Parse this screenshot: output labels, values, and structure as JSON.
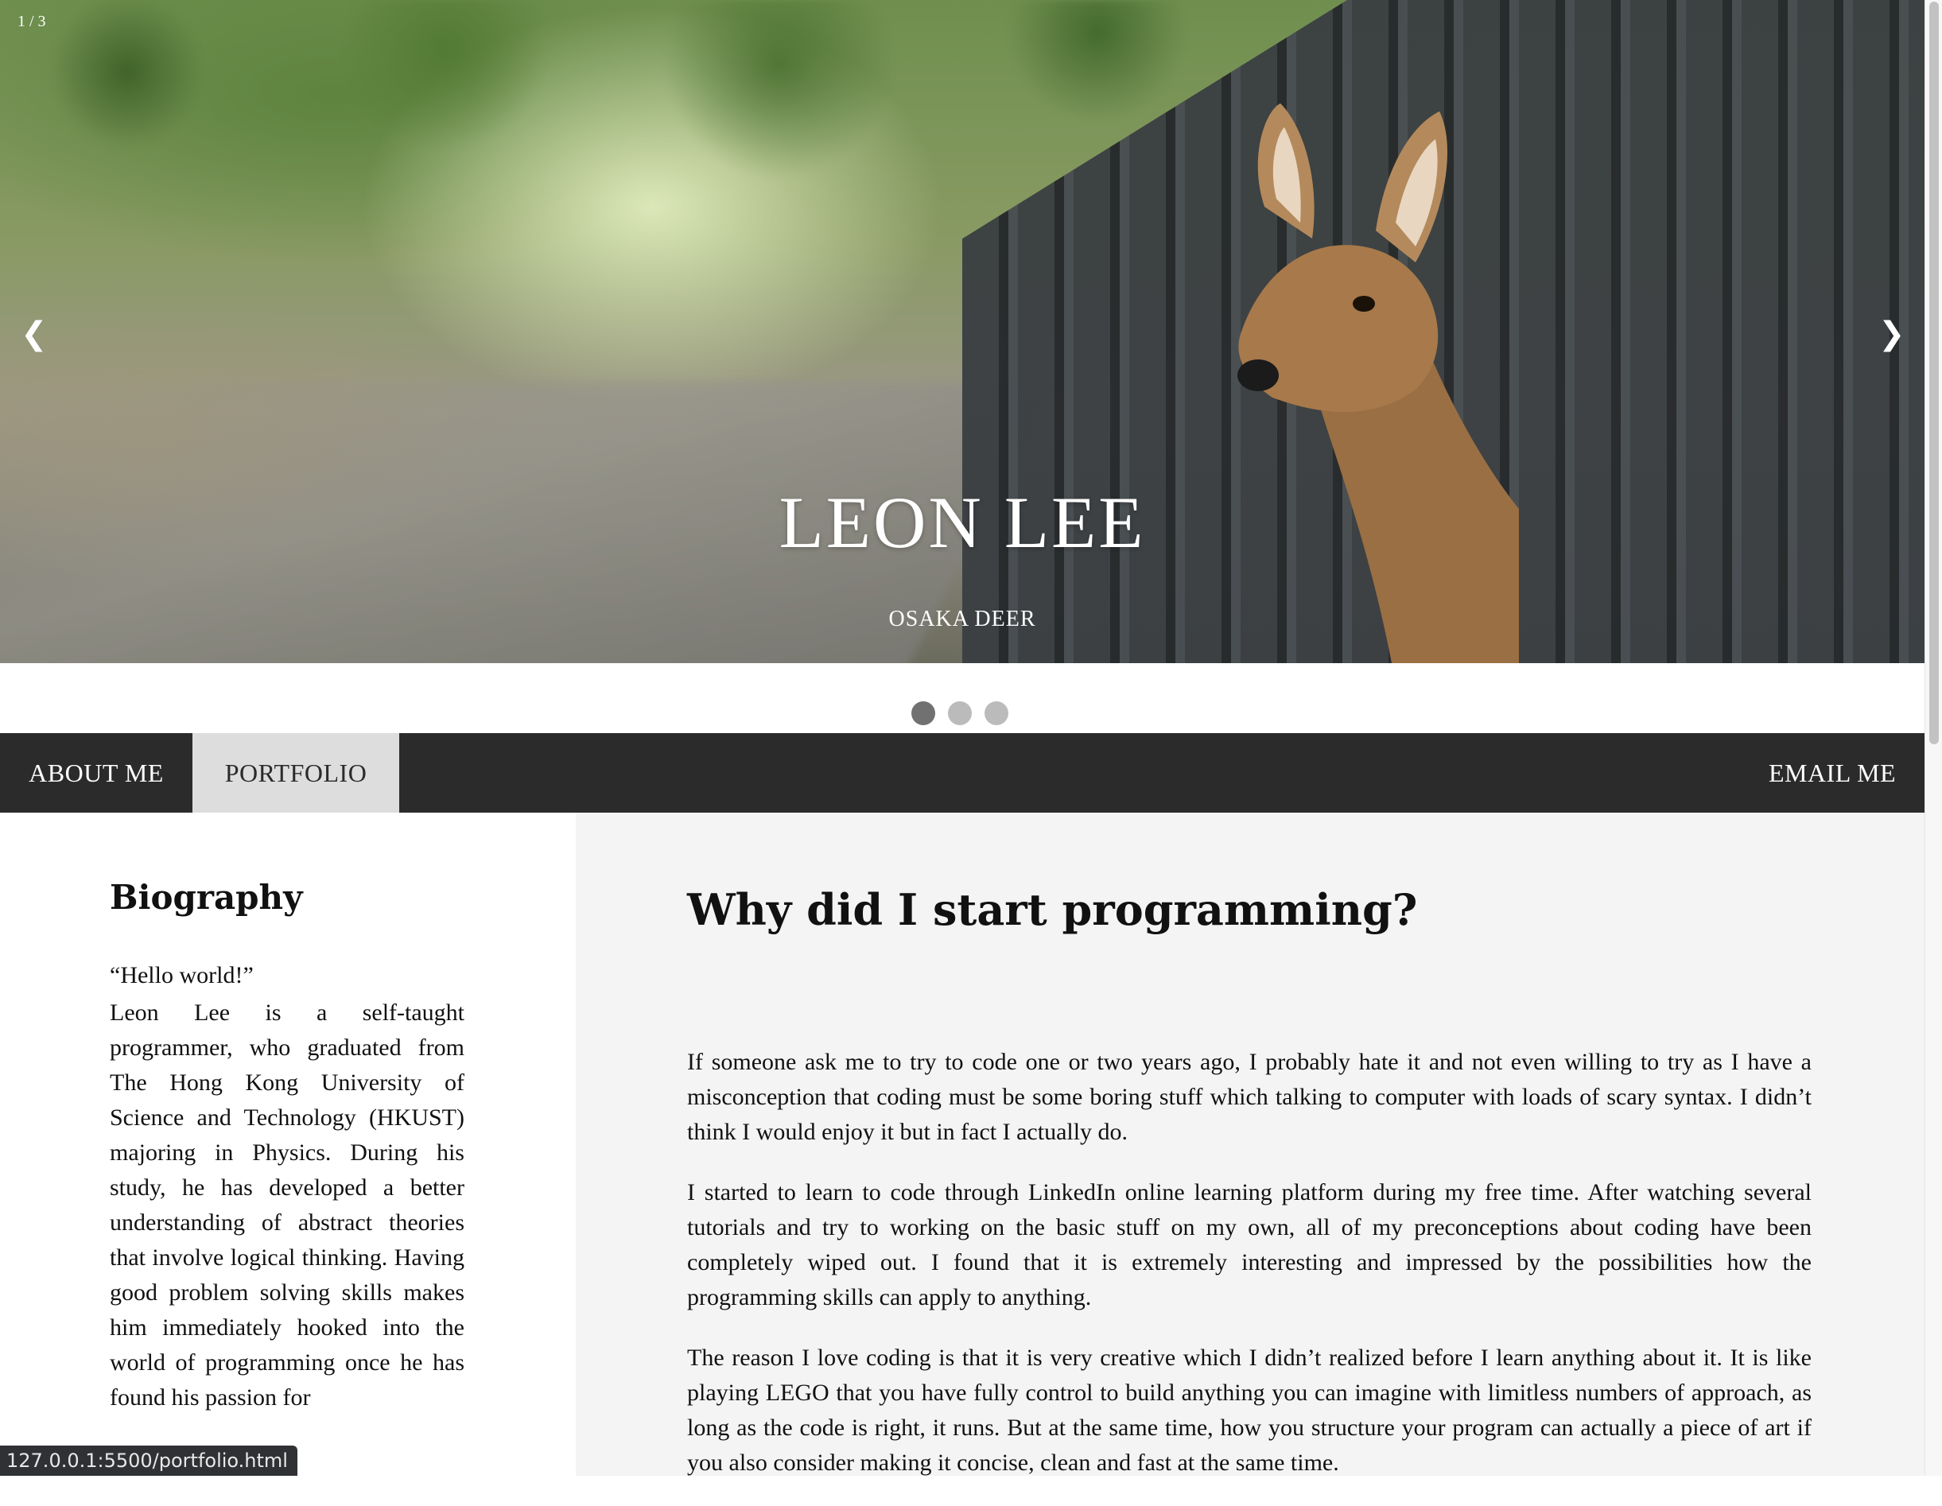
{
  "hero": {
    "counter": "1 / 3",
    "title": "LEON LEE",
    "caption": "OSAKA DEER",
    "prev_arrow": "❮",
    "next_arrow": "❯",
    "slide_count": 3,
    "active_slide": 1
  },
  "nav": {
    "items": [
      {
        "label": "ABOUT ME",
        "active": false
      },
      {
        "label": "PORTFOLIO",
        "active": true
      }
    ],
    "email_label": "EMAIL ME"
  },
  "sidebar": {
    "heading": "Biography",
    "quote": "“Hello world!”",
    "text": "Leon Lee is a self-taught programmer, who graduated from The Hong Kong University of Science and Technology (HKUST) majoring in Physics. During his study, he has developed a better understanding of abstract theories that involve logical thinking. Having good problem solving skills makes him immediately hooked into the world of programming once he has found his passion for"
  },
  "main": {
    "heading": "Why did I start programming?",
    "paragraphs": [
      "If someone ask me to try to code one or two years ago, I probably hate it and not even willing to try as I have a misconception that coding must be some boring stuff which talking to computer with loads of scary syntax. I didn’t think I would enjoy it but in fact I actually do.",
      "I started to learn to code through LinkedIn online learning platform during my free time. After watching several tutorials and try to working on the basic stuff on my own, all of my preconceptions about coding have been completely wiped out. I found that it is extremely interesting and impressed by the possibilities how the programming skills can apply to anything.",
      "The reason I love coding is that it is very creative which I didn’t realized before I learn anything about it. It is like playing LEGO that you have fully control to build anything you can imagine with limitless numbers of approach, as long as the code is right, it runs. But at the same time, how you structure your program can actually a piece of art if you also consider making it concise, clean and fast at the same time."
    ]
  },
  "status_bar": {
    "url": "127.0.0.1:5500/portfolio.html"
  },
  "colors": {
    "nav_background": "#2b2b2b",
    "nav_active_background": "#dddddd",
    "main_background": "#f4f4f4",
    "dot_active": "#717171",
    "dot_inactive": "#bbbbbb"
  }
}
